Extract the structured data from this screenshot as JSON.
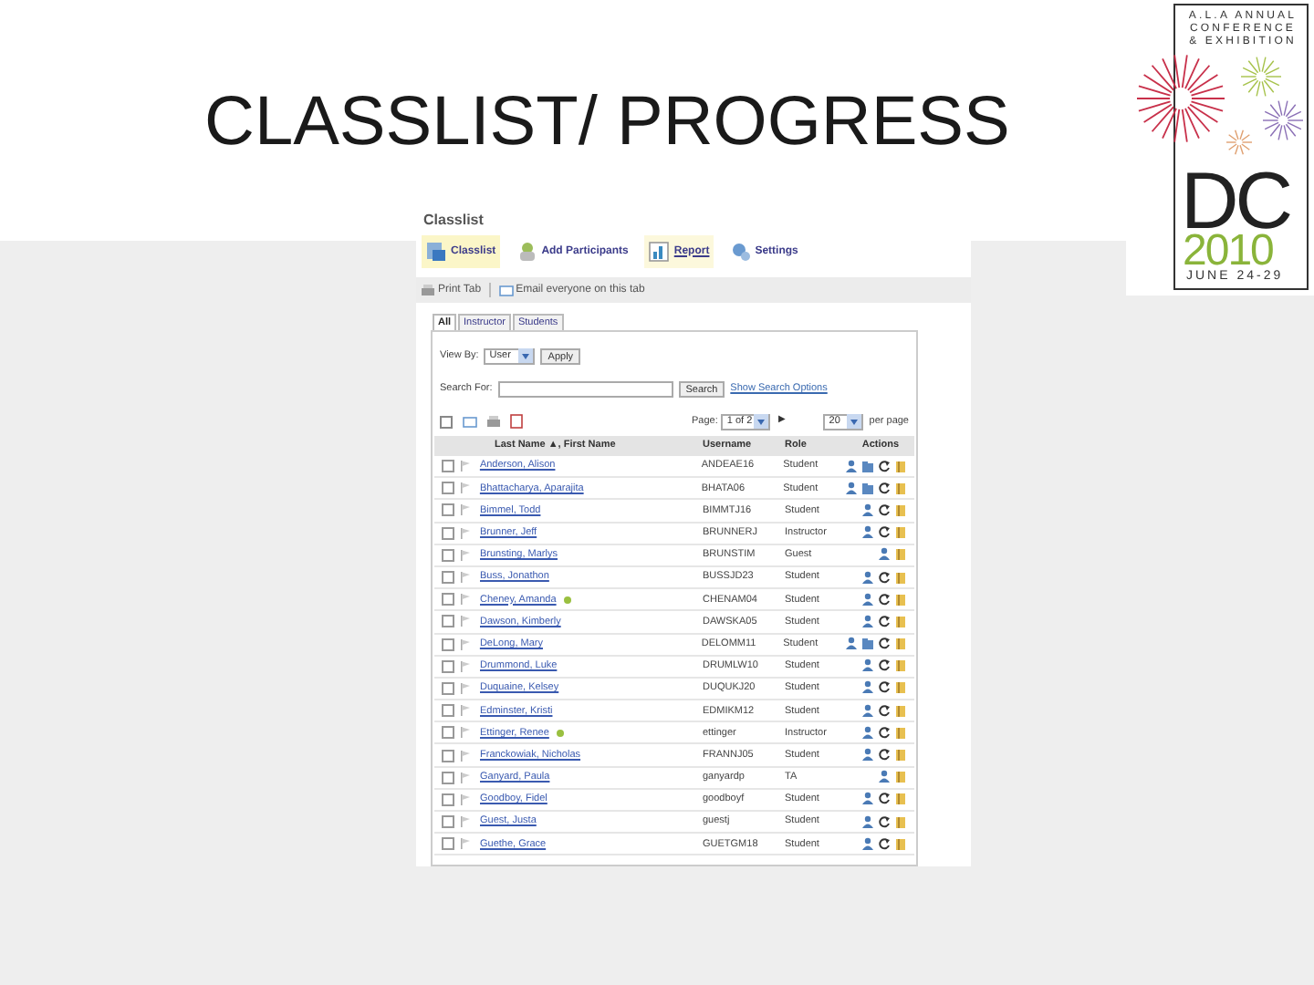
{
  "slide": {
    "title": "CLASSLIST/ PROGRESS"
  },
  "logo": {
    "lines": [
      "A.L.A ANNUAL",
      "CONFERENCE",
      "& EXHIBITION"
    ],
    "city": "DC",
    "year": "2010",
    "dates": "JUNE 24-29"
  },
  "app": {
    "title": "Classlist",
    "nav": [
      {
        "label": "Classlist",
        "kind": "classlist",
        "selected": true,
        "hovered": false
      },
      {
        "label": "Add Participants",
        "kind": "add",
        "selected": false,
        "hovered": false
      },
      {
        "label": "Report",
        "kind": "report",
        "selected": false,
        "hovered": true
      },
      {
        "label": "Settings",
        "kind": "settings",
        "selected": false,
        "hovered": false
      }
    ],
    "toolbar": [
      {
        "label": "Print Tab",
        "kind": "print"
      },
      {
        "label": "Email everyone on this tab",
        "kind": "email"
      }
    ],
    "tabs": [
      {
        "label": "All",
        "selected": true
      },
      {
        "label": "Instructor",
        "selected": false
      },
      {
        "label": "Students",
        "selected": false
      }
    ],
    "view_by": {
      "label": "View By:",
      "value": "User",
      "button": "Apply"
    },
    "search": {
      "label": "Search For:",
      "button": "Search",
      "link": "Show Search Options"
    },
    "paging": {
      "select_all_checked": false,
      "label": "Page:",
      "page": "1 of 2",
      "next": "▶",
      "per_page": "20",
      "per_page_label": "per page"
    },
    "table": {
      "columns": [
        "Last Name ▲, First Name",
        "Username",
        "Role",
        "Actions"
      ],
      "rows": [
        {
          "checked": false,
          "name": "Anderson, Alison",
          "online": false,
          "username": "ANDEAE16",
          "role": "Student",
          "actions": [
            {
              "kind": "user"
            },
            {
              "kind": "folder"
            },
            {
              "kind": "refresh"
            },
            {
              "kind": "book"
            }
          ]
        },
        {
          "checked": false,
          "name": "Bhattacharya, Aparajita",
          "online": false,
          "username": "BHATA06",
          "role": "Student",
          "actions": [
            {
              "kind": "user"
            },
            {
              "kind": "folder"
            },
            {
              "kind": "refresh"
            },
            {
              "kind": "book"
            }
          ]
        },
        {
          "checked": false,
          "name": "Bimmel, Todd",
          "online": false,
          "username": "BIMMTJ16",
          "role": "Student",
          "actions": [
            {
              "kind": "user"
            },
            {
              "kind": "refresh"
            },
            {
              "kind": "book"
            }
          ]
        },
        {
          "checked": false,
          "name": "Brunner, Jeff",
          "online": false,
          "username": "BRUNNERJ",
          "role": "Instructor",
          "actions": [
            {
              "kind": "user"
            },
            {
              "kind": "refresh"
            },
            {
              "kind": "book"
            }
          ]
        },
        {
          "checked": false,
          "name": "Brunsting, Marlys",
          "online": false,
          "username": "BRUNSTIM",
          "role": "Guest",
          "actions": [
            {
              "kind": "user"
            },
            {
              "kind": "book"
            }
          ]
        },
        {
          "checked": false,
          "name": "Buss, Jonathon",
          "online": false,
          "username": "BUSSJD23",
          "role": "Student",
          "actions": [
            {
              "kind": "user"
            },
            {
              "kind": "refresh"
            },
            {
              "kind": "book"
            }
          ]
        },
        {
          "checked": false,
          "name": "Cheney, Amanda",
          "online": true,
          "username": "CHENAM04",
          "role": "Student",
          "actions": [
            {
              "kind": "user"
            },
            {
              "kind": "refresh"
            },
            {
              "kind": "book"
            }
          ]
        },
        {
          "checked": false,
          "name": "Dawson, Kimberly",
          "online": false,
          "username": "DAWSKA05",
          "role": "Student",
          "actions": [
            {
              "kind": "user"
            },
            {
              "kind": "refresh"
            },
            {
              "kind": "book"
            }
          ]
        },
        {
          "checked": false,
          "name": "DeLong, Mary",
          "online": false,
          "username": "DELOMM11",
          "role": "Student",
          "actions": [
            {
              "kind": "user"
            },
            {
              "kind": "folder"
            },
            {
              "kind": "refresh"
            },
            {
              "kind": "book"
            }
          ]
        },
        {
          "checked": false,
          "name": "Drummond, Luke",
          "online": false,
          "username": "DRUMLW10",
          "role": "Student",
          "actions": [
            {
              "kind": "user"
            },
            {
              "kind": "refresh"
            },
            {
              "kind": "book"
            }
          ]
        },
        {
          "checked": false,
          "name": "Duquaine, Kelsey",
          "online": false,
          "username": "DUQUKJ20",
          "role": "Student",
          "actions": [
            {
              "kind": "user"
            },
            {
              "kind": "refresh"
            },
            {
              "kind": "book"
            }
          ]
        },
        {
          "checked": false,
          "name": "Edminster, Kristi",
          "online": false,
          "username": "EDMIKM12",
          "role": "Student",
          "actions": [
            {
              "kind": "user"
            },
            {
              "kind": "refresh"
            },
            {
              "kind": "book"
            }
          ]
        },
        {
          "checked": false,
          "name": "Ettinger, Renee",
          "online": true,
          "username": "ettinger",
          "role": "Instructor",
          "actions": [
            {
              "kind": "user"
            },
            {
              "kind": "refresh"
            },
            {
              "kind": "book"
            }
          ]
        },
        {
          "checked": false,
          "name": "Franckowiak, Nicholas",
          "online": false,
          "username": "FRANNJ05",
          "role": "Student",
          "actions": [
            {
              "kind": "user"
            },
            {
              "kind": "refresh"
            },
            {
              "kind": "book"
            }
          ]
        },
        {
          "checked": false,
          "name": "Ganyard, Paula",
          "online": false,
          "username": "ganyardp",
          "role": "TA",
          "actions": [
            {
              "kind": "user"
            },
            {
              "kind": "book"
            }
          ]
        },
        {
          "checked": false,
          "name": "Goodboy, Fidel",
          "online": false,
          "username": "goodboyf",
          "role": "Student",
          "actions": [
            {
              "kind": "user"
            },
            {
              "kind": "refresh"
            },
            {
              "kind": "book"
            }
          ]
        },
        {
          "checked": false,
          "name": "Guest, Justa",
          "online": false,
          "username": "guestj",
          "role": "Student",
          "actions": [
            {
              "kind": "user"
            },
            {
              "kind": "refresh"
            },
            {
              "kind": "book"
            }
          ]
        },
        {
          "checked": false,
          "name": "Guethe, Grace",
          "online": false,
          "username": "GUETGM18",
          "role": "Student",
          "actions": [
            {
              "kind": "user"
            },
            {
              "kind": "refresh"
            },
            {
              "kind": "book"
            }
          ]
        }
      ]
    }
  }
}
